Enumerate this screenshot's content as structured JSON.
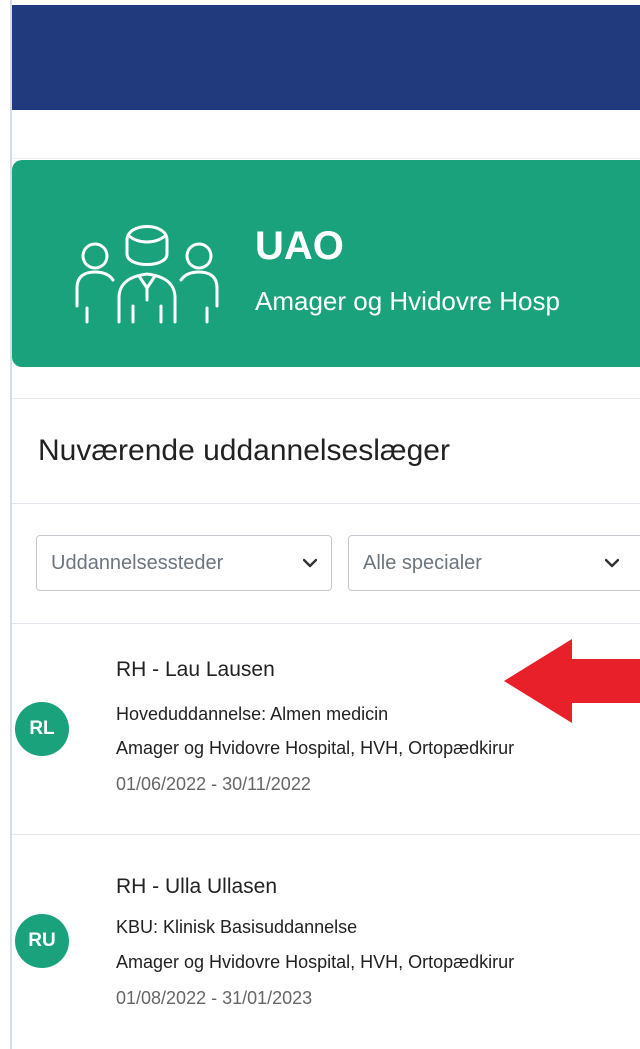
{
  "hero": {
    "title": "UAO",
    "subtitle": "Amager og Hvidovre Hosp",
    "icon": "users-group-icon",
    "color": "#1aa27d"
  },
  "topbar": {
    "color": "#213a7d"
  },
  "section": {
    "title": "Nuværende uddannelseslæger",
    "filters": [
      {
        "label": "Uddannelsessteder"
      },
      {
        "label": "Alle specialer"
      }
    ]
  },
  "doctors": [
    {
      "initials": "RL",
      "name": "RH - Lau Lausen",
      "education": "Hoveduddannelse: Almen medicin",
      "location": "Amager og Hvidovre Hospital, HVH, Ortopædkirur",
      "period": "01/06/2022 - 30/11/2022"
    },
    {
      "initials": "RU",
      "name": "RH - Ulla Ullasen",
      "education": "KBU: Klinisk Basisuddannelse",
      "location": "Amager og Hvidovre Hospital, HVH, Ortopædkirur",
      "period": "01/08/2022 - 31/01/2023"
    }
  ],
  "annotation": {
    "icon": "red-arrow-left-icon",
    "color": "#e8202a"
  }
}
